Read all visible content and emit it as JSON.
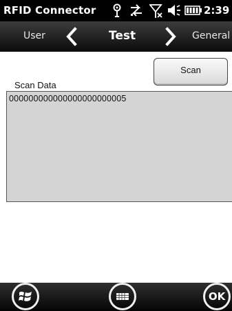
{
  "status_bar": {
    "app_title": "RFID Connector",
    "clock": "2:39",
    "icons": [
      "connection-icon",
      "data-transfer-icon",
      "signal-no-service-icon",
      "volume-icon",
      "battery-icon"
    ]
  },
  "nav": {
    "prev_label": "User",
    "current_label": "Test",
    "next_label": "General"
  },
  "content": {
    "scan_button_label": "Scan",
    "scan_data_label": "Scan Data",
    "scan_data_value": "000000000000000000000005"
  },
  "bottom_bar": {
    "start_icon": "windows-start-icon",
    "keyboard_icon": "keyboard-icon",
    "ok_label": "OK"
  }
}
